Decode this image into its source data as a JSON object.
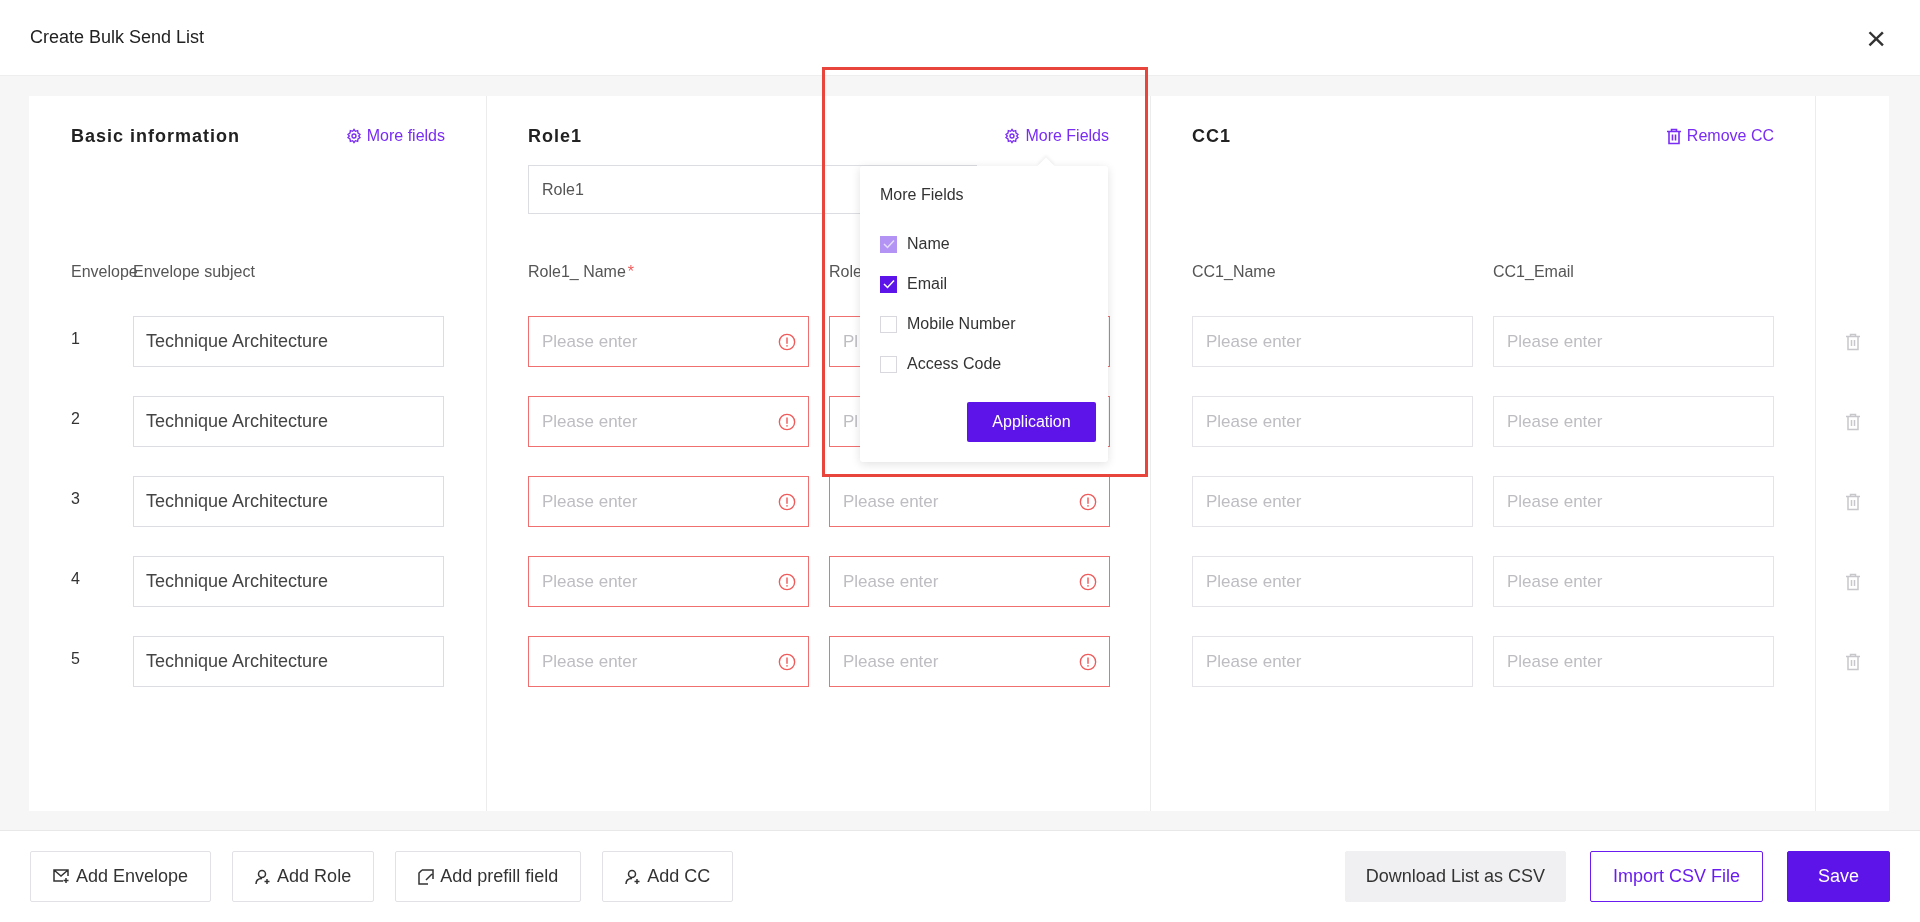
{
  "dialog": {
    "title": "Create Bulk Send List",
    "close": "×"
  },
  "basic": {
    "title": "Basic information",
    "more_link": "More fields",
    "columns": [
      "Envelope",
      "Envelope subject"
    ],
    "rows": [
      {
        "number": "1",
        "subject": "Technique Architecture"
      },
      {
        "number": "2",
        "subject": "Technique Architecture"
      },
      {
        "number": "3",
        "subject": "Technique Architecture"
      },
      {
        "number": "4",
        "subject": "Technique Architecture"
      },
      {
        "number": "5",
        "subject": "Technique Architecture"
      }
    ]
  },
  "role": {
    "title": "Role1",
    "more_link": "More Fields",
    "name_value": "Role1",
    "columns": [
      {
        "label": "Role1_ Name",
        "required_mark": "*"
      },
      {
        "label": "Role"
      }
    ],
    "rows": [
      [
        {
          "placeholder": "Please enter",
          "invalid": true,
          "alert": true
        },
        {
          "placeholder": "Pl",
          "invalid": true,
          "alert": false
        }
      ],
      [
        {
          "placeholder": "Please enter",
          "invalid": true,
          "alert": true
        },
        {
          "placeholder": "Pl",
          "invalid": true,
          "alert": false
        }
      ],
      [
        {
          "placeholder": "Please enter",
          "invalid": true,
          "alert": true
        },
        {
          "placeholder": "Please enter",
          "invalid": true,
          "alert": true
        }
      ],
      [
        {
          "placeholder": "Please enter",
          "invalid": true,
          "alert": true
        },
        {
          "placeholder": "Please enter",
          "invalid": true,
          "alert": true
        }
      ],
      [
        {
          "placeholder": "Please enter",
          "invalid": true,
          "alert": true
        },
        {
          "placeholder": "Please enter",
          "invalid": true,
          "alert": true
        }
      ]
    ]
  },
  "cc": {
    "title": "CC1",
    "remove_link": "Remove CC",
    "columns": [
      {
        "label": "CC1_Name"
      },
      {
        "label": "CC1_Email"
      }
    ],
    "rows": [
      [
        {
          "placeholder": "Please enter",
          "invalid": false,
          "alert": false
        },
        {
          "placeholder": "Please enter",
          "invalid": false,
          "alert": false
        }
      ],
      [
        {
          "placeholder": "Please enter",
          "invalid": false,
          "alert": false
        },
        {
          "placeholder": "Please enter",
          "invalid": false,
          "alert": false
        }
      ],
      [
        {
          "placeholder": "Please enter",
          "invalid": false,
          "alert": false
        },
        {
          "placeholder": "Please enter",
          "invalid": false,
          "alert": false
        }
      ],
      [
        {
          "placeholder": "Please enter",
          "invalid": false,
          "alert": false
        },
        {
          "placeholder": "Please enter",
          "invalid": false,
          "alert": false
        }
      ],
      [
        {
          "placeholder": "Please enter",
          "invalid": false,
          "alert": false
        },
        {
          "placeholder": "Please enter",
          "invalid": false,
          "alert": false
        }
      ]
    ]
  },
  "more_fields_popup": {
    "title": "More Fields",
    "options": [
      {
        "label": "Name",
        "checked": true,
        "disabled": true
      },
      {
        "label": "Email",
        "checked": true,
        "disabled": false
      },
      {
        "label": "Mobile Number",
        "checked": false,
        "disabled": false
      },
      {
        "label": "Access Code",
        "checked": false,
        "disabled": false
      }
    ],
    "apply_button": "Application"
  },
  "footer": {
    "left_buttons": [
      {
        "label": "Add Envelope",
        "kind": "envelope"
      },
      {
        "label": "Add Role",
        "kind": "role"
      },
      {
        "label": "Add prefill field",
        "kind": "prefill"
      },
      {
        "label": "Add CC",
        "kind": "cc"
      }
    ],
    "right_buttons": [
      {
        "label": "Download List as CSV",
        "kind": "secondary"
      },
      {
        "label": "Import CSV File",
        "kind": "outline"
      },
      {
        "label": "Save",
        "kind": "primary"
      }
    ]
  }
}
